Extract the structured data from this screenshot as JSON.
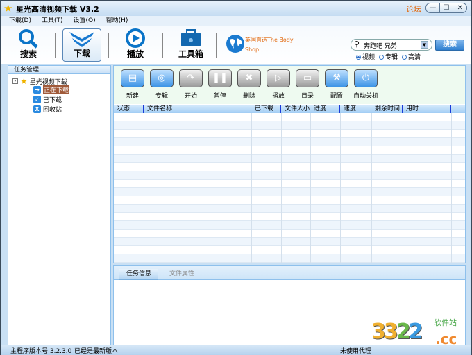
{
  "window": {
    "title": "星光高清视频下载 V3.2",
    "forum": "论坛",
    "controls": [
      "—",
      "☐",
      "✕"
    ]
  },
  "menu": [
    "下载(D)",
    "工具(T)",
    "设置(O)",
    "帮助(H)"
  ],
  "toolbar": [
    {
      "label": "搜索",
      "icon": "search-icon"
    },
    {
      "label": "下载",
      "icon": "download-icon"
    },
    {
      "label": "播放",
      "icon": "play-icon"
    },
    {
      "label": "工具箱",
      "icon": "toolbox-icon"
    }
  ],
  "ad": {
    "text": "英国直送The Body Shop"
  },
  "search": {
    "value": "奔跑吧 兄弟",
    "button": "搜索",
    "options": [
      "视频",
      "专辑",
      "高清"
    ],
    "selected": "视频"
  },
  "tasks": {
    "header": "任务管理",
    "root": "星光视频下载",
    "items": [
      "正在下载",
      "已下载",
      "回收站"
    ]
  },
  "actions": [
    "新建",
    "专辑",
    "开始",
    "暂停",
    "删除",
    "播放",
    "目录",
    "配置",
    "自动关机"
  ],
  "columns": [
    "状态",
    "文件名称",
    "已下载",
    "文件大小",
    "进度",
    "速度",
    "剩余时间",
    "用时"
  ],
  "tabs": [
    "任务信息",
    "文件属性"
  ],
  "status": {
    "version": "主程序版本号 3.2.3.0",
    "update": "已经是最新版本",
    "proxy": "未使用代理"
  },
  "watermark": {
    "text": "3322.cc 软件站"
  }
}
